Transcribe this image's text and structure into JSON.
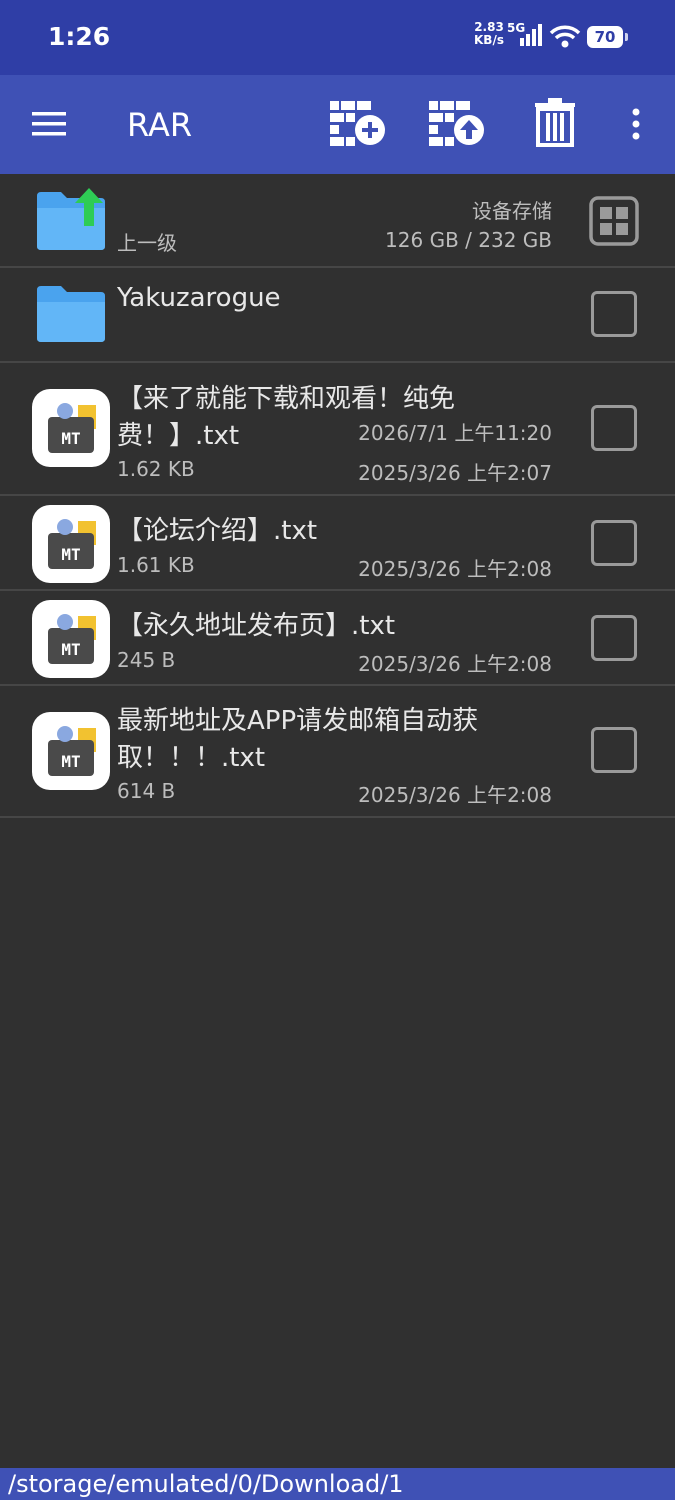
{
  "status_bar": {
    "time": "1:26",
    "net_speed": "2.83",
    "net_unit": "KB/s",
    "network": "5G",
    "battery": "70"
  },
  "toolbar": {
    "title": "RAR",
    "accent": "#3f51b5",
    "icons": [
      "menu-icon",
      "archive-add-icon",
      "archive-extract-icon",
      "delete-icon",
      "more-vert-icon"
    ]
  },
  "parent": {
    "label": "上一级",
    "storage_name": "设备存储",
    "storage_usage": "126 GB / 232 GB"
  },
  "files": [
    {
      "type": "folder",
      "name": "Yakuzarogue",
      "size": "",
      "date": "2026/7/1 上午11:20"
    },
    {
      "type": "txt",
      "name_line1": "【来了就能下载和观看！纯免",
      "name_line2": "费！】.txt",
      "size": "1.62 KB",
      "date": "2025/3/26 上午2:07"
    },
    {
      "type": "txt",
      "name_line1": "【论坛介绍】.txt",
      "size": "1.61 KB",
      "date": "2025/3/26 上午2:08"
    },
    {
      "type": "txt",
      "name_line1": "【永久地址发布页】.txt",
      "size": "245 B",
      "date": "2025/3/26 上午2:08"
    },
    {
      "type": "txt",
      "name_line1": "最新地址及APP请发邮箱自动获",
      "name_line2": "取！！！.txt",
      "size": "614 B",
      "date": "2025/3/26 上午2:08"
    }
  ],
  "file_icon_text": "MT",
  "path": "/storage/emulated/0/Download/1"
}
